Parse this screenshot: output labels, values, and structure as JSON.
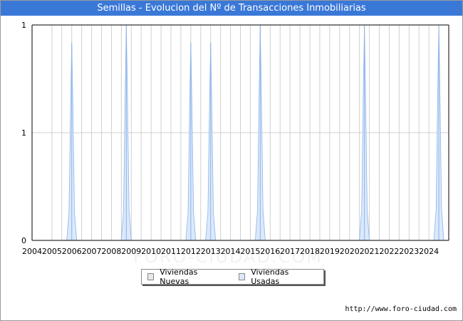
{
  "title": "Semillas - Evolucion del Nº de Transacciones Inmobiliarias",
  "source": "http://www.foro-ciudad.com",
  "watermark": "FORO-CIUDAD.COM",
  "colors": {
    "title_bg": "#3a78d8",
    "nuevas_fill": "#e8e8e8",
    "usadas_fill": "#dbe9fb",
    "usadas_stroke": "#8db4e8",
    "grid": "#d0d0d0"
  },
  "legend": {
    "nuevas": "Viviendas Nuevas",
    "usadas": "Viviendas Usadas"
  },
  "chart_data": {
    "type": "area",
    "title": "Semillas - Evolucion del Nº de Transacciones Inmobiliarias",
    "xlim": [
      2004,
      2025
    ],
    "ylim": [
      0,
      1.2
    ],
    "x_ticks": [
      "2004",
      "2005",
      "2006",
      "2007",
      "2008",
      "2009",
      "2010",
      "2011",
      "2012",
      "2013",
      "2014",
      "2015",
      "2016",
      "2017",
      "2018",
      "2019",
      "2020",
      "2021",
      "2022",
      "2023",
      "2024"
    ],
    "y_ticks": [
      {
        "value": 0,
        "label": "0"
      },
      {
        "value": 0.6,
        "label": "1"
      },
      {
        "value": 1.2,
        "label": "1"
      }
    ],
    "grid": true,
    "legend_position": "bottom-center",
    "series": [
      {
        "name": "Viviendas Nuevas",
        "points": []
      },
      {
        "name": "Viviendas Usadas",
        "points": [
          {
            "x": 2006.0,
            "y": 1.1
          },
          {
            "x": 2008.75,
            "y": 1.2
          },
          {
            "x": 2012.0,
            "y": 1.1
          },
          {
            "x": 2013.0,
            "y": 1.1
          },
          {
            "x": 2015.5,
            "y": 1.2
          },
          {
            "x": 2020.75,
            "y": 1.2
          },
          {
            "x": 2024.5,
            "y": 1.2
          }
        ]
      }
    ]
  }
}
